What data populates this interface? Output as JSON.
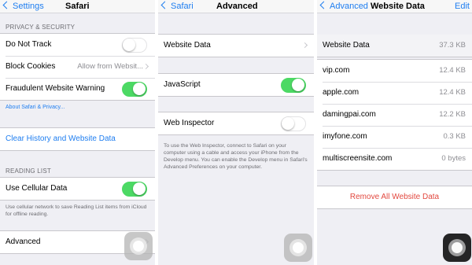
{
  "panel1": {
    "back_label": "Settings",
    "title": "Safari",
    "privacy_header": "PRIVACY & SECURITY",
    "do_not_track": "Do Not Track",
    "block_cookies": "Block Cookies",
    "block_cookies_value": "Allow from Websit...",
    "fraud_warning": "Fraudulent Website Warning",
    "about_link": "About Safari & Privacy...",
    "clear_history": "Clear History and Website Data",
    "reading_header": "READING LIST",
    "use_cellular": "Use Cellular Data",
    "cellular_note": "Use cellular network to save Reading List items from iCloud for offline reading.",
    "advanced": "Advanced",
    "toggles": {
      "do_not_track": false,
      "fraud_warning": true,
      "use_cellular": true
    }
  },
  "panel2": {
    "back_label": "Safari",
    "title": "Advanced",
    "website_data": "Website Data",
    "javascript": "JavaScript",
    "web_inspector": "Web Inspector",
    "inspector_note": "To use the Web Inspector, connect to Safari on your computer using a cable and access your iPhone from the Develop menu. You can enable the Develop menu in Safari's Advanced Preferences on your computer.",
    "toggles": {
      "javascript": true,
      "web_inspector": false
    }
  },
  "panel3": {
    "back_label": "Advanced",
    "title": "Website Data",
    "edit_label": "Edit",
    "total_label": "Website Data",
    "total_size": "37.3 KB",
    "sites": [
      {
        "name": "vip.com",
        "size": "12.4 KB"
      },
      {
        "name": "apple.com",
        "size": "12.4 KB"
      },
      {
        "name": "damingpai.com",
        "size": "12.2 KB"
      },
      {
        "name": "imyfone.com",
        "size": "0.3 KB"
      },
      {
        "name": "multiscreensite.com",
        "size": "0 bytes"
      }
    ],
    "remove_all": "Remove All Website Data"
  },
  "colors": {
    "accent": "#1f7ef0",
    "toggle_on": "#4cd964",
    "destructive": "#e2483f",
    "background": "#efeff4"
  },
  "icons": {
    "back": "chevron-left-icon",
    "disclosure": "chevron-right-icon",
    "assistive_touch": "assistive-touch-icon"
  }
}
